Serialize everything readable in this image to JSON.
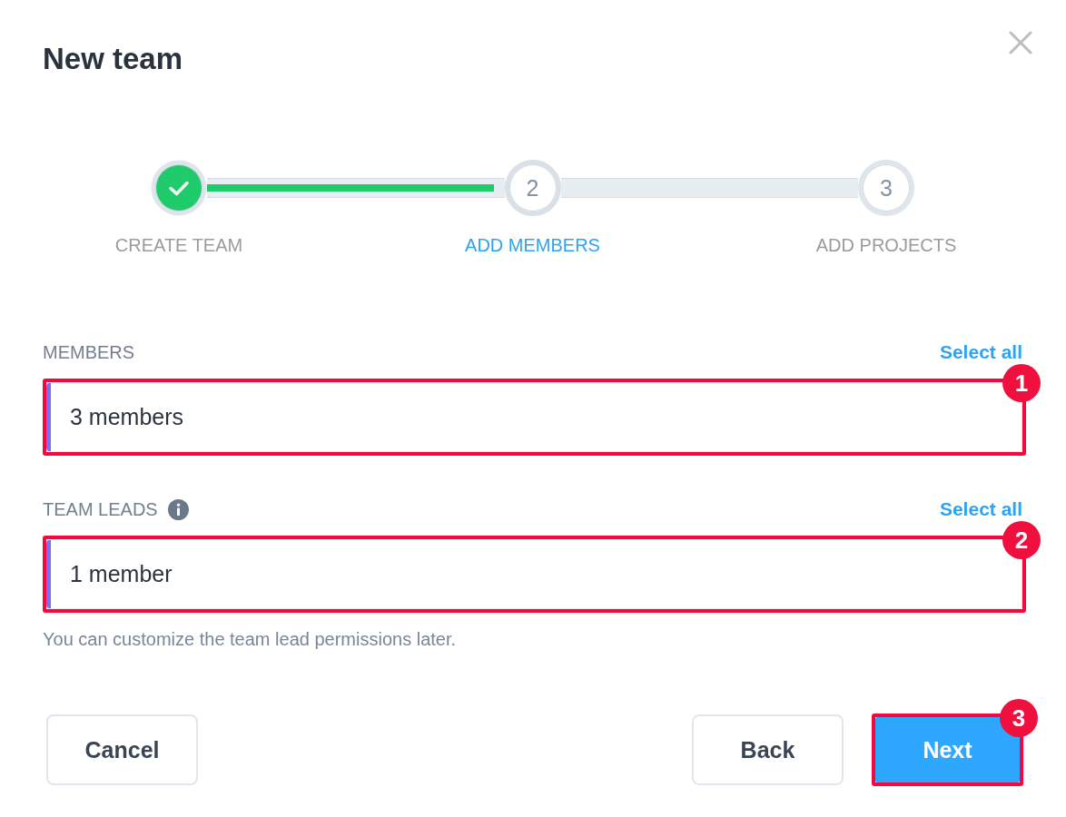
{
  "dialog": {
    "title": "New team"
  },
  "stepper": {
    "steps": [
      {
        "label": "CREATE TEAM",
        "kind": "completed"
      },
      {
        "number": "2",
        "label": "ADD MEMBERS",
        "kind": "current"
      },
      {
        "number": "3",
        "label": "ADD PROJECTS",
        "kind": "upcoming"
      }
    ]
  },
  "fields": [
    {
      "label": "MEMBERS",
      "info": false,
      "action": "Select all",
      "value": "3 members",
      "callout": "1"
    },
    {
      "label": "TEAM LEADS",
      "info": true,
      "action": "Select all",
      "value": "1 member",
      "callout": "2",
      "hint": "You can customize the team lead permissions later."
    }
  ],
  "footer": {
    "left_buttons": [
      {
        "label": "Cancel",
        "kind": "secondary"
      }
    ],
    "right_buttons": [
      {
        "label": "Back",
        "kind": "secondary"
      },
      {
        "label": "Next",
        "kind": "primary",
        "callout": "3"
      }
    ]
  }
}
